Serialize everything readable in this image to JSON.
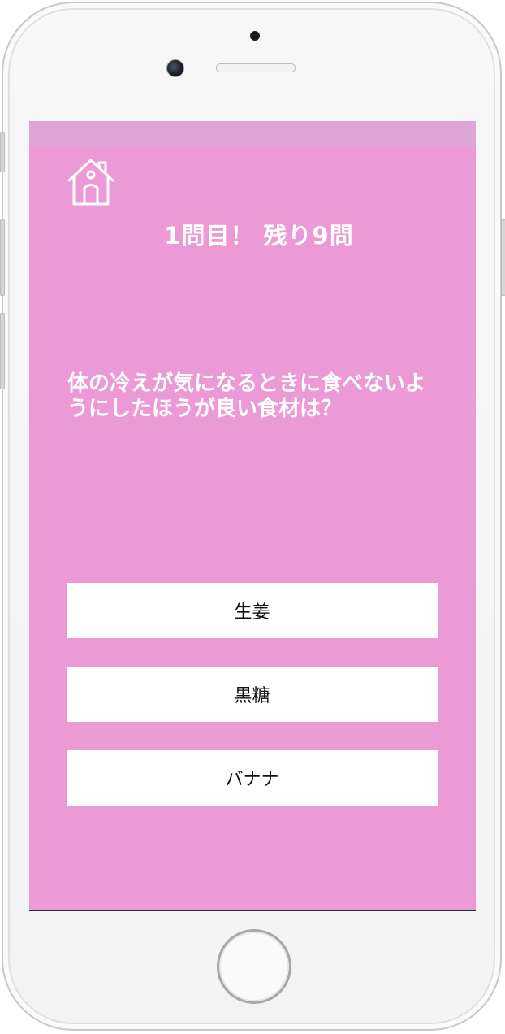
{
  "quiz": {
    "progress_text": "1問目！ 残り9問",
    "question": "体の冷えが気になるときに食べないようにしたほうが良い食材は？",
    "answers": [
      {
        "label": "生姜"
      },
      {
        "label": "黒糖"
      },
      {
        "label": "バナナ"
      }
    ]
  },
  "icons": {
    "home": "house-icon"
  },
  "colors": {
    "background": "#ec9ad6",
    "status_bar": "#dda6d4",
    "answer_button": "#ffffff",
    "text_light": "#ffffff",
    "text_dark": "#111111"
  }
}
